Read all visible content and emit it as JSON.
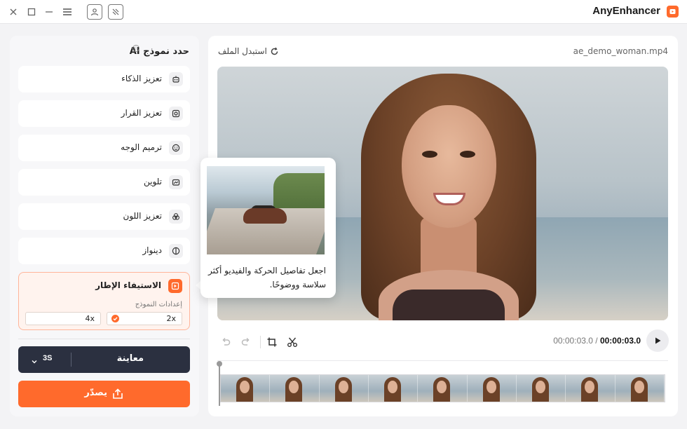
{
  "window": {
    "app_title": "AnyEnhancer",
    "controls": [
      "close-icon",
      "maximize-icon",
      "minimize-icon",
      "menu-icon",
      "account-icon",
      "feedback-icon"
    ]
  },
  "left_panel": {
    "title": "حدد نموذج AI",
    "models": [
      {
        "label": "تعزيز الذكاء",
        "icon": "robot-icon"
      },
      {
        "label": "تعزيز القرار",
        "icon": "resolution-icon"
      },
      {
        "label": "ترميم الوجه",
        "icon": "face-icon"
      },
      {
        "label": "تلوين",
        "icon": "colorize-icon"
      },
      {
        "label": "تعزيز اللون",
        "icon": "color-enhance-icon"
      },
      {
        "label": "دينواز",
        "icon": "denoise-icon"
      },
      {
        "label": "الاستيفاء الإطار",
        "icon": "frame-interpolation-icon",
        "active": true
      }
    ],
    "model_settings_label": "إعدادات النموذج",
    "options": [
      {
        "value": "2x",
        "selected": true
      },
      {
        "value": "4x",
        "selected": false
      }
    ],
    "preview_label": "معاينة",
    "preview_duration": "3S",
    "export_label": "يصدّر"
  },
  "right_panel": {
    "file_name": "ae_demo_woman.mp4",
    "replace_label": "استبدل الملف",
    "tooltip_text": "اجعل تفاصيل الحركة والفيديو أكثر سلاسة ووضوحًا.",
    "current_time": "00:00:03.0",
    "separator": "/",
    "total_time": "00:00:03.0",
    "tools": [
      "undo-icon",
      "redo-icon",
      "crop-icon",
      "cut-icon"
    ]
  },
  "colors": {
    "accent": "#ff6a2c",
    "dark_button": "#2b3040"
  }
}
